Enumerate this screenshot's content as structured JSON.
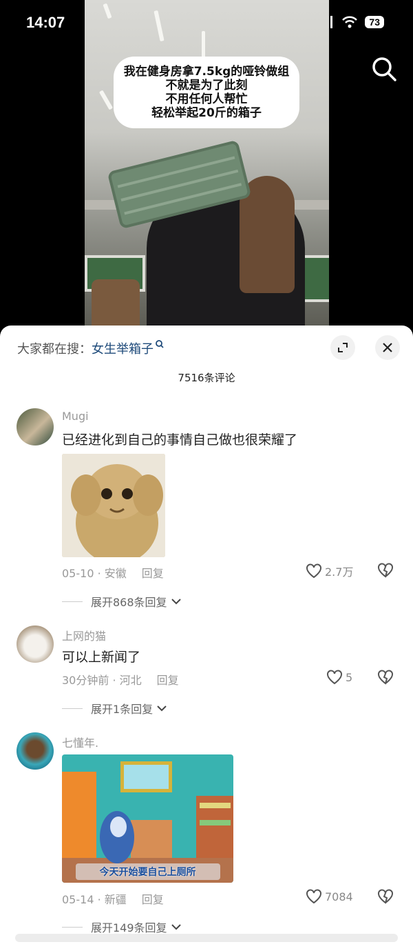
{
  "status_bar": {
    "time": "14:07",
    "network": "4G",
    "battery": "73"
  },
  "video": {
    "caption_lines": [
      "我在健身房拿7.5kg的哑铃做组",
      "不就是为了此刻",
      "不用任何人帮忙",
      "轻松举起20斤的箱子"
    ]
  },
  "sheet": {
    "hot_search_prefix": "大家都在搜：",
    "hot_search_term": "女生举箱子",
    "comment_count": "7516条评论"
  },
  "comments": [
    {
      "username": "Mugi",
      "text": "已经进化到自己的事情自己做也很荣耀了",
      "date": "05-10",
      "location": "安徽",
      "reply_label": "回复",
      "likes": "2.7万",
      "expand": "展开868条回复"
    },
    {
      "username": "上网的猫",
      "text": "可以上新闻了",
      "date": "30分钟前",
      "location": "河北",
      "reply_label": "回复",
      "likes": "5",
      "expand": "展开1条回复"
    },
    {
      "username": "七懂年.",
      "image_caption": "今天开始要自己上厕所",
      "date": "05-14",
      "location": "新疆",
      "reply_label": "回复",
      "likes": "7084",
      "expand": "展开149条回复"
    }
  ]
}
